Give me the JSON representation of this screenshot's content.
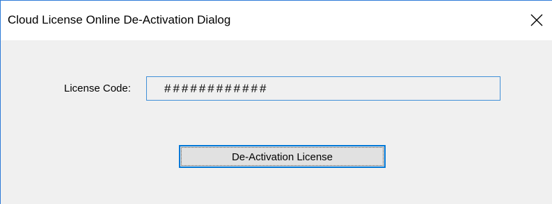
{
  "window": {
    "title": "Cloud License Online De-Activation Dialog",
    "close_icon": "close-icon"
  },
  "form": {
    "license_label": "License Code:",
    "license_value": "############"
  },
  "actions": {
    "deactivate_label": "De-Activation License"
  },
  "colors": {
    "accent": "#0078d7",
    "background": "#f0f0f0",
    "titlebar": "#ffffff"
  }
}
